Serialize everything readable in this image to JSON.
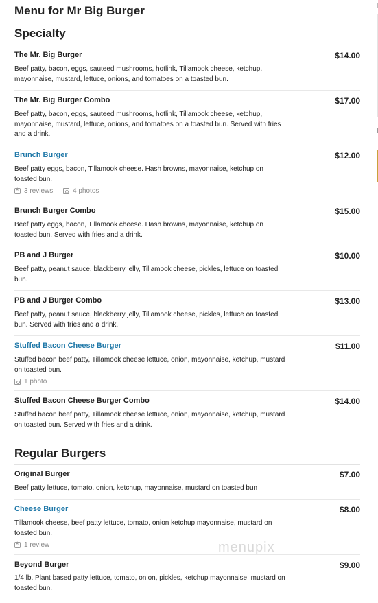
{
  "page_title": "Menu for Mr Big Burger",
  "sections": [
    {
      "title": "Specialty",
      "items": [
        {
          "name": "The Mr. Big Burger",
          "price": "$14.00",
          "desc": "Beef patty, bacon, eggs, sauteed mushrooms, hotlink, Tillamook cheese, ketchup, mayonnaise, mustard, lettuce, onions, and tomatoes on a toasted bun."
        },
        {
          "name": "The Mr. Big Burger Combo",
          "price": "$17.00",
          "desc": "Beef patty, bacon, eggs, sauteed mushrooms, hotlink, Tillamook cheese, ketchup, mayonnaise, mustard, lettuce, onions, and tomatoes on a toasted bun. Served with fries and a drink."
        },
        {
          "name": "Brunch Burger",
          "price": "$12.00",
          "desc": "Beef patty eggs, bacon, Tillamook cheese. Hash browns, mayonnaise, ketchup on toasted bun.",
          "reviews": "3 reviews",
          "photos": "4 photos"
        },
        {
          "name": "Brunch Burger Combo",
          "price": "$15.00",
          "desc": "Beef patty eggs, bacon, Tillamook cheese. Hash browns, mayonnaise, ketchup on toasted bun. Served with fries and a drink."
        },
        {
          "name": "PB and J Burger",
          "price": "$10.00",
          "desc": "Beef patty, peanut sauce, blackberry jelly, Tillamook cheese, pickles, lettuce on toasted bun."
        },
        {
          "name": "PB and J Burger Combo",
          "price": "$13.00",
          "desc": "Beef patty, peanut sauce, blackberry jelly, Tillamook cheese, pickles, lettuce on toasted bun. Served with fries and a drink."
        },
        {
          "name": "Stuffed Bacon Cheese Burger",
          "price": "$11.00",
          "desc": "Stuffed bacon beef patty, Tillamook cheese lettuce, onion, mayonnaise, ketchup, mustard on toasted bun.",
          "photos": "1 photo"
        },
        {
          "name": "Stuffed Bacon Cheese Burger Combo",
          "price": "$14.00",
          "desc": "Stuffed bacon beef patty, Tillamook cheese lettuce, onion, mayonnaise, ketchup, mustard on toasted bun. Served with fries and a drink."
        }
      ]
    },
    {
      "title": "Regular Burgers",
      "items": [
        {
          "name": "Original Burger",
          "price": "$7.00",
          "desc": "Beef patty lettuce, tomato, onion, ketchup, mayonnaise, mustard on toasted bun"
        },
        {
          "name": "Cheese Burger",
          "price": "$8.00",
          "desc": "Tillamook cheese, beef patty lettuce, tomato, onion ketchup mayonnaise, mustard on toasted bun.",
          "reviews": "1 review"
        },
        {
          "name": "Beyond Burger",
          "price": "$9.00",
          "desc": "1/4 lb. Plant based patty lettuce, tomato, onion, pickles, ketchup mayonnaise, mustard on toasted bun."
        }
      ]
    }
  ],
  "watermark": "menupix",
  "colors": {
    "link": "#1f78a8",
    "text": "#222222",
    "meta": "#8a8a8a"
  }
}
